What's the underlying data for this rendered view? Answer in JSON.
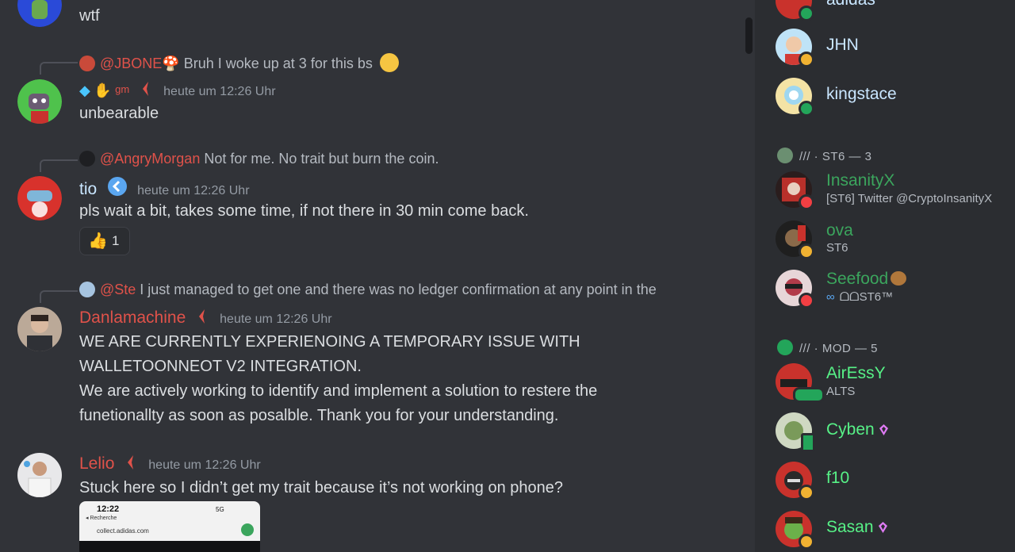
{
  "messages": [
    {
      "content": "wtf"
    },
    {
      "reply": {
        "mention": "@JBONE",
        "text": " Bruh I woke up at 3 for this bs"
      },
      "tag": "gm",
      "timestamp": "heute um 12:26 Uhr",
      "content": "unbearable"
    },
    {
      "reply": {
        "mention": "@AngryMorgan",
        "text": " Not for me. No trait but burn the coin."
      },
      "username": "tio",
      "timestamp": "heute um 12:26 Uhr",
      "content": "pls wait a bit, takes some time, if not there in 30 min come back.",
      "reaction": {
        "emoji": "thumbs-up",
        "count": "1"
      }
    },
    {
      "reply": {
        "mention": "@Ste",
        "text": " I just managed to get one and there was no ledger confirmation at any point in the"
      },
      "username": "Danlamachine",
      "timestamp": "heute um 12:26 Uhr",
      "lines": [
        "WE ARE CURRENTLY EXPERIENOING A TEMPORARY ISSUE WITH",
        "WALLETOONNEOT V2 INTEGRATION.",
        "We are actively working to identify and implement a solution to restere the",
        "funetionallty as soon as posalble. Thank you for your understanding."
      ]
    },
    {
      "username": "Lelio",
      "timestamp": "heute um 12:26 Uhr",
      "content": "Stuck here so I didn’t get my trait because it’s not working on phone?",
      "attachment": {
        "time": "12:22",
        "back": "◂ Recherche",
        "url": "collect.adidas.com",
        "signal": "5G"
      }
    }
  ],
  "members": {
    "top_partial": "adidas",
    "top": [
      {
        "name": "JHN",
        "status": "idle"
      },
      {
        "name": "kingstace",
        "status": "online"
      }
    ],
    "section_st6": {
      "label": "/// · ST6 — 3",
      "items": [
        {
          "name": "InsanityX",
          "sub": "[ST6] Twitter @CryptoInsanityX",
          "status": "dnd",
          "color": "#3ba55d"
        },
        {
          "name": "ova",
          "sub": "ST6",
          "status": "idle",
          "color": "#3ba55d"
        },
        {
          "name": "Seefood",
          "sub": "ᗝᗝST6™",
          "status": "dnd",
          "color": "#3ba55d"
        }
      ]
    },
    "section_mod": {
      "label": "/// · MOD — 5",
      "items": [
        {
          "name": "AirEssY",
          "sub": "ALTS",
          "status": "online",
          "color": "#57f287"
        },
        {
          "name": "Cyben",
          "status": "mobile",
          "color": "#57f287"
        },
        {
          "name": "f10",
          "status": "idle",
          "color": "#57f287"
        },
        {
          "name": "Sasan",
          "status": "idle",
          "color": "#57f287"
        }
      ]
    }
  },
  "colors": {
    "background": "#313338",
    "sidebar": "#2b2d31",
    "mention": "#e0524a",
    "username_red": "#e0524a",
    "username_blue": "#c9e6ff"
  }
}
